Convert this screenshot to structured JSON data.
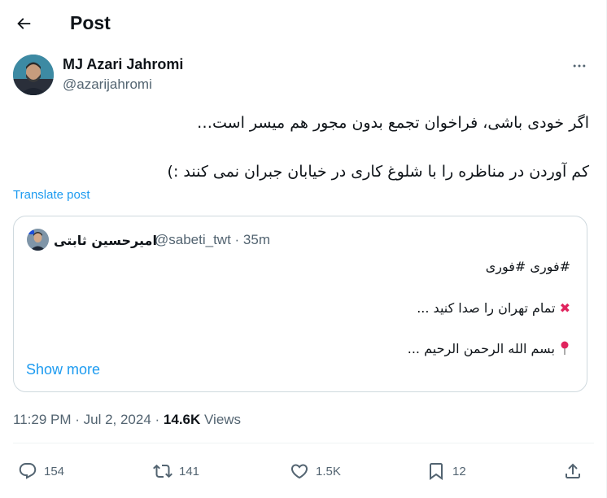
{
  "header": {
    "title": "Post"
  },
  "author": {
    "name": "MJ Azari Jahromi",
    "handle": "@azarijahromi"
  },
  "post": {
    "paragraph1": "اگر خودی باشی، فراخوان تجمع بدون مجور هم میسر است…",
    "paragraph2": "کم آوردن در مناظره را با شلوغ کاری در خیابان جبران نمی کنند :)",
    "translate_label": "Translate post"
  },
  "quote": {
    "name": "امیرحسین ثابتی",
    "handle_time": "@sabeti_twt · 35m",
    "line1": "#فوری #فوری",
    "line2": "تمام تهران را صدا کنید ...",
    "line3": "بسم الله الرحمن الرحیم ...",
    "show_more": "Show more"
  },
  "meta": {
    "time_date": "11:29 PM · Jul 2, 2024 · ",
    "views_count": "14.6K",
    "views_label": " Views"
  },
  "actions": {
    "replies": "154",
    "reposts": "141",
    "likes": "1.5K",
    "bookmarks": "12"
  },
  "icons": [
    "back-arrow-icon",
    "more-icon",
    "cross-mark-icon",
    "pushpin-icon",
    "reply-icon",
    "retweet-icon",
    "like-icon",
    "bookmark-icon",
    "share-icon"
  ],
  "colors": {
    "link": "#1d9bf0",
    "muted": "#536471",
    "text": "#0f1419",
    "border": "#cfd9de"
  }
}
